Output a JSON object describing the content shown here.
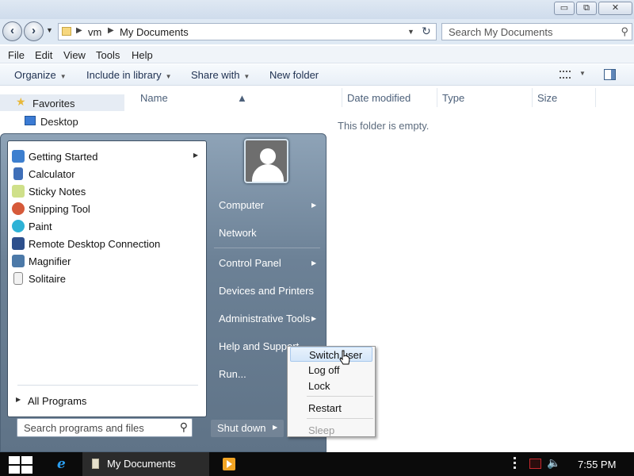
{
  "window": {
    "caption_buttons": {
      "minimize": "▭",
      "restore": "⧉",
      "close": "✕"
    },
    "address": {
      "crumbs": [
        "vm",
        "My Documents"
      ]
    },
    "search_placeholder": "Search My Documents",
    "menu": [
      "File",
      "Edit",
      "View",
      "Tools",
      "Help"
    ],
    "commands": {
      "organize": "Organize",
      "include": "Include in library",
      "share": "Share with",
      "new_folder": "New folder"
    },
    "nav": {
      "favorites": "Favorites",
      "desktop": "Desktop"
    },
    "columns": [
      "Name",
      "Date modified",
      "Type",
      "Size"
    ],
    "empty_message": "This folder is empty."
  },
  "start_menu": {
    "programs": [
      {
        "label": "Getting Started",
        "icon": "getting-started-icon",
        "has_submenu": true
      },
      {
        "label": "Calculator",
        "icon": "calculator-icon",
        "has_submenu": false
      },
      {
        "label": "Sticky Notes",
        "icon": "sticky-notes-icon",
        "has_submenu": false
      },
      {
        "label": "Snipping Tool",
        "icon": "snipping-tool-icon",
        "has_submenu": false
      },
      {
        "label": "Paint",
        "icon": "paint-icon",
        "has_submenu": false
      },
      {
        "label": "Remote Desktop Connection",
        "icon": "remote-desktop-icon",
        "has_submenu": false
      },
      {
        "label": "Magnifier",
        "icon": "magnifier-icon",
        "has_submenu": false
      },
      {
        "label": "Solitaire",
        "icon": "solitaire-icon",
        "has_submenu": false
      }
    ],
    "all_programs": "All Programs",
    "search_placeholder": "Search programs and files",
    "right_links": {
      "computer": "Computer",
      "network": "Network",
      "control_panel": "Control Panel",
      "devices": "Devices and Printers",
      "admin_tools": "Administrative Tools",
      "help": "Help and Support",
      "run": "Run..."
    },
    "shutdown": "Shut down"
  },
  "shutdown_menu": {
    "items": [
      "Switch user",
      "Log off",
      "Lock",
      "Restart",
      "Sleep"
    ],
    "highlighted": "Switch user",
    "disabled": "Sleep"
  },
  "taskbar": {
    "task_label": "My Documents",
    "clock": "7:55 PM"
  },
  "colors": {
    "start_menu_bg": "#6c8196",
    "taskbar_bg": "#0b0b0b",
    "highlight": "#d4e6f9"
  }
}
